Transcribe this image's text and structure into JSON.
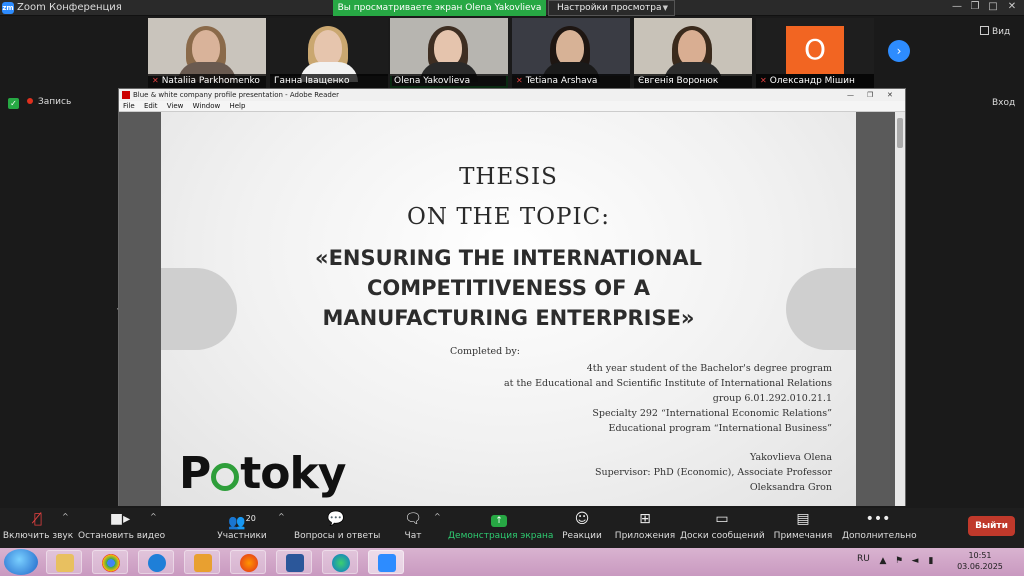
{
  "zoom": {
    "app_title": "Zoom Конференция",
    "share_banner": "Вы просматриваете экран Olena Yakovlieva",
    "view_settings": "Настройки просмотра",
    "view_button": "Вид",
    "recording": "Запись",
    "exit_fullscreen": "Вход",
    "participants": [
      {
        "name": "Nataliia Parkhomenko",
        "muted": true
      },
      {
        "name": "Ганна Іващенко",
        "muted": false
      },
      {
        "name": "Olena Yakovlieva",
        "muted": false
      },
      {
        "name": "Tetiana Arshava",
        "muted": true
      },
      {
        "name": "Євгенія Воронюк",
        "muted": false
      },
      {
        "name": "Олександр Мішин",
        "muted": true,
        "avatar_letter": "O"
      }
    ]
  },
  "reader": {
    "title": "Blue & white company profile presentation - Adobe Reader",
    "menu": [
      "File",
      "Edit",
      "View",
      "Window",
      "Help"
    ]
  },
  "slide": {
    "thesis_line1": "THESIS",
    "thesis_line2": "ON THE TOPIC:",
    "topic_line1": "«ENSURING THE INTERNATIONAL",
    "topic_line2": "COMPETITIVENESS OF A",
    "topic_line3": "MANUFACTURING ENTERPRISE»",
    "completed_by": "Completed by:",
    "details": [
      "4th year student of the Bachelor's degree program",
      "at the Educational and Scientific Institute of International Relations",
      "group 6.01.292.010.21.1",
      "Specialty 292 “International Economic Relations”",
      "Educational program “International Business”"
    ],
    "author": "Yakovlieva Olena",
    "supervisor": "Supervisor: PhD (Economic), Associate Professor",
    "supervisor_name": "Oleksandra Gron",
    "logo_p": "P",
    "logo_rest": "toky"
  },
  "toolbar": {
    "unmute": "Включить звук",
    "stop_video": "Остановить видео",
    "participants": "Участники",
    "participants_count": "20",
    "qa": "Вопросы и ответы",
    "chat": "Чат",
    "share": "Демонстрация экрана",
    "reactions": "Реакции",
    "apps": "Приложения",
    "whiteboards": "Доски сообщений",
    "notes": "Примечания",
    "more": "Дополнительно",
    "leave": "Выйти"
  },
  "taskbar": {
    "lang": "RU",
    "time": "10:51",
    "date": "03.06.2025"
  },
  "colors": {
    "accent": "#27a844",
    "zoom_blue": "#2d8cff",
    "leave_red": "#c0392b",
    "logo_green": "#2e9e3a"
  }
}
